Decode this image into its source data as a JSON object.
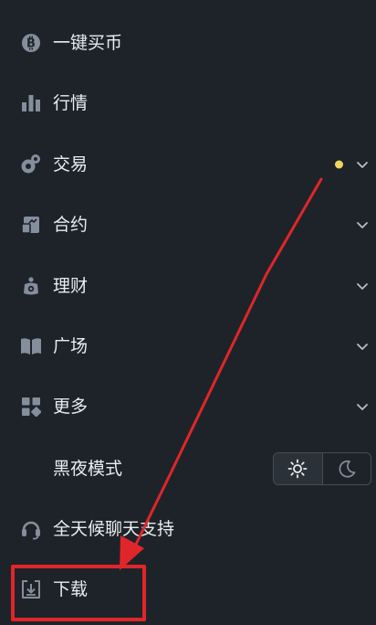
{
  "menu": {
    "items": [
      {
        "label": "一键买币",
        "icon": "bitcoin-coin-icon"
      },
      {
        "label": "行情",
        "icon": "bar-chart-icon"
      },
      {
        "label": "交易",
        "icon": "trade-icon",
        "has_chevron": true,
        "has_notification_dot": true
      },
      {
        "label": "合约",
        "icon": "contract-icon",
        "has_chevron": true
      },
      {
        "label": "理财",
        "icon": "earn-icon",
        "has_chevron": true
      },
      {
        "label": "广场",
        "icon": "book-icon",
        "has_chevron": true
      },
      {
        "label": "更多",
        "icon": "grid-icon",
        "has_chevron": true
      },
      {
        "label": "黑夜模式",
        "icon": "",
        "theme_toggle": {
          "selected": "light",
          "options": [
            "sun-icon",
            "moon-icon"
          ]
        }
      },
      {
        "label": "全天候聊天支持",
        "icon": "headset-icon"
      },
      {
        "label": "下载",
        "icon": "download-icon"
      }
    ]
  },
  "annotation": {
    "arrow_color": "#e0262a",
    "highlighted_item": "下载"
  },
  "colors": {
    "background": "#1e2329",
    "text": "#eaecef",
    "icon": "#848e9c",
    "notification_dot": "#f0d45c",
    "annotation_red": "#e0262a"
  }
}
